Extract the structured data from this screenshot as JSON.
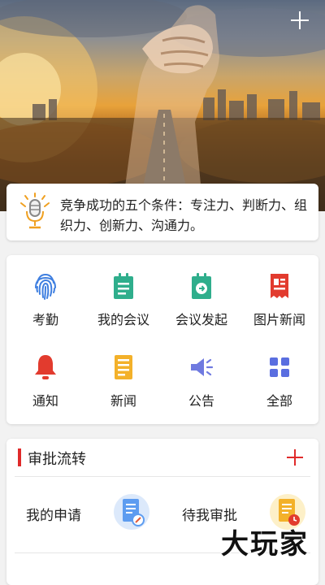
{
  "banner": {
    "image_name": "handshake-city-sunset-banner"
  },
  "quote": {
    "icon": "microphone-icon",
    "text": "竞争成功的五个条件：专注力、判断力、组织力、创新力、沟通力。"
  },
  "grid": {
    "items": [
      {
        "label": "考勤",
        "icon": "fingerprint-icon",
        "color": "#3f7fe0"
      },
      {
        "label": "我的会议",
        "icon": "meeting-doc-icon",
        "color": "#2fae8c"
      },
      {
        "label": "会议发起",
        "icon": "meeting-start-icon",
        "color": "#2fae8c"
      },
      {
        "label": "图片新闻",
        "icon": "picture-news-icon",
        "color": "#e23b2e"
      },
      {
        "label": "通知",
        "icon": "bell-icon",
        "color": "#e23b2e"
      },
      {
        "label": "新闻",
        "icon": "news-icon",
        "color": "#f3b12a"
      },
      {
        "label": "公告",
        "icon": "speaker-icon",
        "color": "#6f7ae0"
      },
      {
        "label": "全部",
        "icon": "grid-apps-icon",
        "color": "#5a6ee0"
      }
    ]
  },
  "approval": {
    "title": "审批流转",
    "accent": "#e02a2a",
    "items": [
      {
        "label": "我的申请",
        "icon": "my-application-icon"
      },
      {
        "label": "待我审批",
        "icon": "pending-approval-icon"
      }
    ]
  },
  "watermark": {
    "text": "大玩家"
  }
}
